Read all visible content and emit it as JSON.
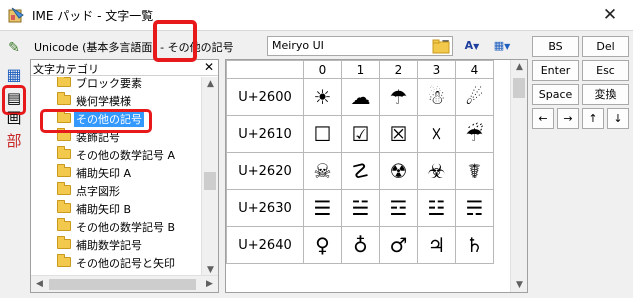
{
  "window": {
    "title": "IME パッド - 文字一覧",
    "close": "✕"
  },
  "left_strip": [
    {
      "name": "handwriting",
      "glyph": "✎"
    },
    {
      "name": "char-list",
      "glyph": "▦"
    },
    {
      "name": "soft-keyboard",
      "glyph": "▤"
    },
    {
      "name": "stroke-count",
      "glyph": "画"
    },
    {
      "name": "radical",
      "glyph": "部"
    }
  ],
  "range": "Unicode (基本多言語面) - その他の記号",
  "font": {
    "value": "Meiryo UI"
  },
  "toolbar": {
    "font_btn": "A",
    "view_btn": "▦"
  },
  "category": {
    "header": "文字カテゴリ",
    "close": "✕",
    "items": [
      "ブロック要素",
      "幾何学模様",
      "その他の記号",
      "装飾記号",
      "その他の数学記号 A",
      "補助矢印 A",
      "点字図形",
      "補助矢印 B",
      "その他の数学記号 B",
      "補助数学記号",
      "その他の記号と矢印"
    ],
    "selected_index": 2
  },
  "grid": {
    "columns": [
      "0",
      "1",
      "2",
      "3",
      "4"
    ],
    "rows": [
      {
        "code": "U+2600",
        "chars": [
          "☀",
          "☁",
          "☂",
          "☃",
          "☄"
        ]
      },
      {
        "code": "U+2610",
        "chars": [
          "☐",
          "☑",
          "☒",
          "☓",
          "☔"
        ]
      },
      {
        "code": "U+2620",
        "chars": [
          "☠",
          "☡",
          "☢",
          "☣",
          "☤"
        ]
      },
      {
        "code": "U+2630",
        "chars": [
          "☰",
          "☱",
          "☲",
          "☳",
          "☴"
        ]
      },
      {
        "code": "U+2640",
        "chars": [
          "♀",
          "♁",
          "♂",
          "♃",
          "♄"
        ]
      }
    ]
  },
  "keys": {
    "bs": "BS",
    "del": "Del",
    "enter": "Enter",
    "esc": "Esc",
    "space": "Space",
    "convert": "変換",
    "left": "←",
    "right": "→",
    "up": "↑",
    "down": "↓"
  },
  "colors": {
    "highlight": "#e8191b",
    "selection": "#3399ff"
  }
}
